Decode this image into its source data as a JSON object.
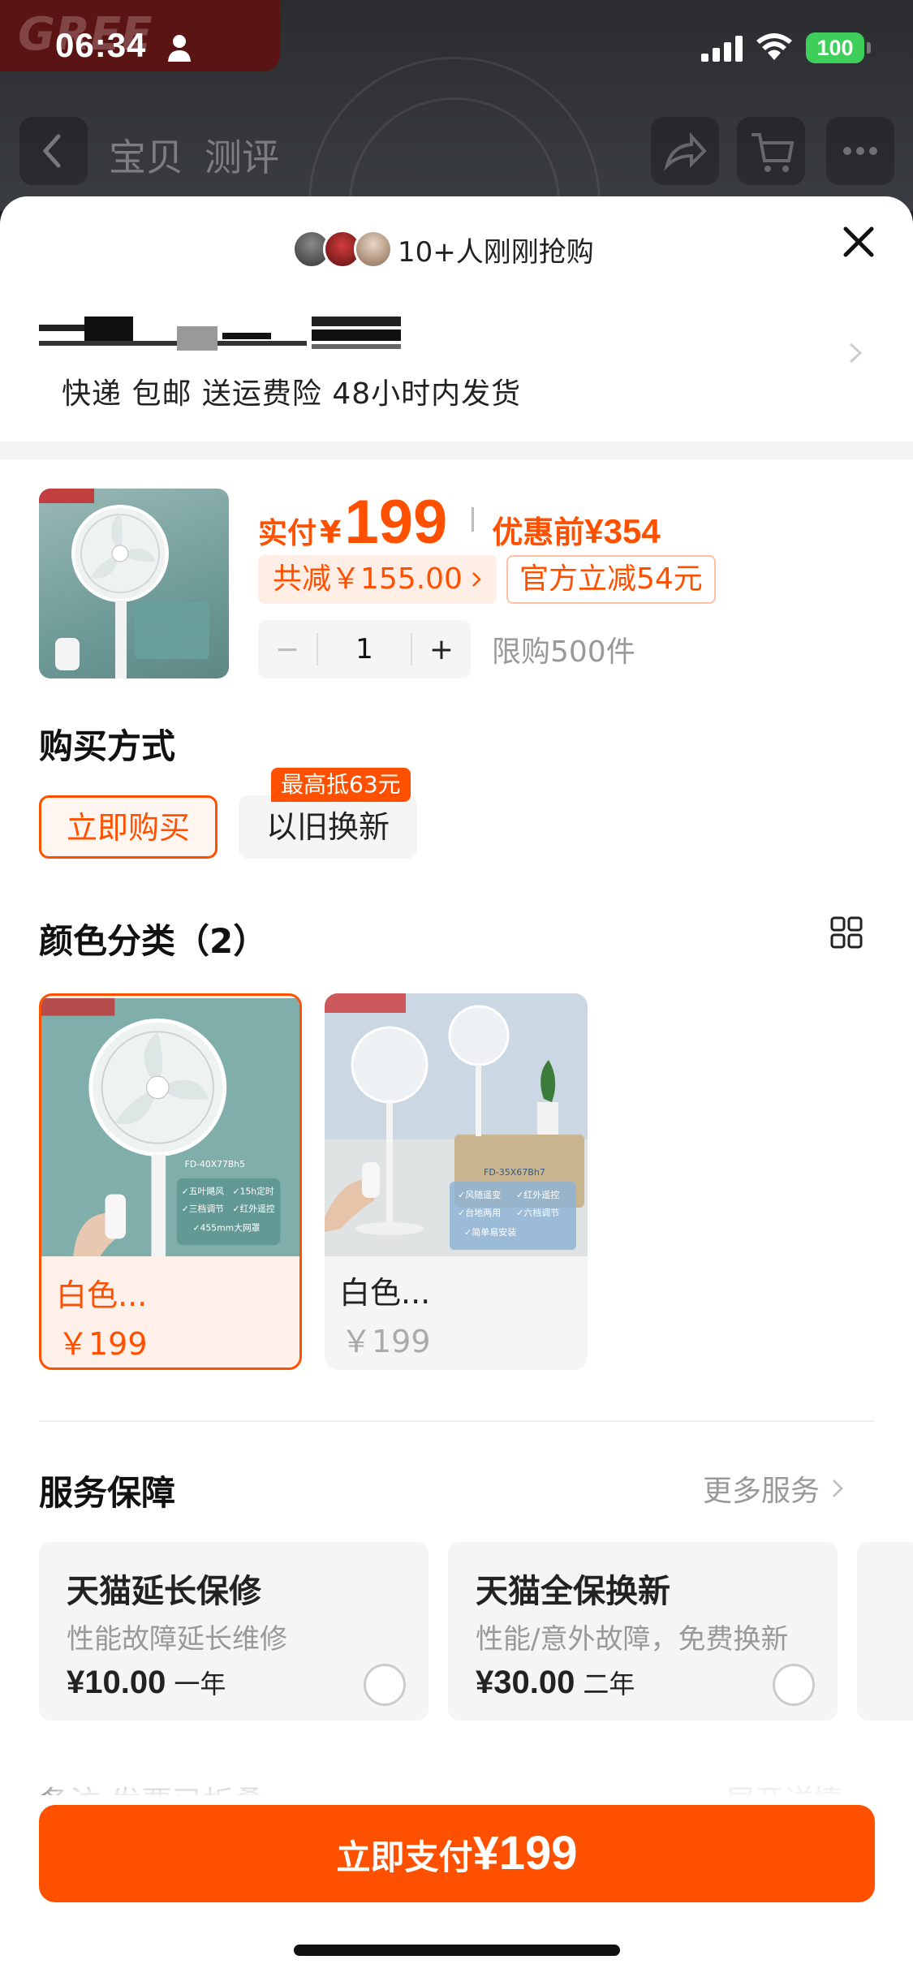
{
  "status_bar": {
    "time": "06:34",
    "battery": "100"
  },
  "background_page": {
    "tabs": [
      "宝贝",
      "测评"
    ]
  },
  "sheet": {
    "buyers_text": "10+人刚刚抢购",
    "shipping": "快递 包邮 送运费险 48小时内发货"
  },
  "product": {
    "pay_label": "实付",
    "yen": "¥",
    "pay_amount": "199",
    "orig_label": "优惠前",
    "orig_amount": "¥354",
    "discount_total": "共减￥155.00",
    "discount_official": "官方立减54元",
    "quantity": "1",
    "limit": "限购500件"
  },
  "purchase_method": {
    "title": "购买方式",
    "options": [
      "立即购买",
      "以旧换新"
    ],
    "selected": "立即购买",
    "trade_badge": "最高抵63元"
  },
  "colors": {
    "title": "颜色分类（2）",
    "variants": [
      {
        "name": "白色...",
        "price": "￥199"
      },
      {
        "name": "白色...",
        "price": "￥199"
      }
    ],
    "product_labels": {
      "v1_model": "FD-40X77Bh5",
      "v1_features": [
        "✓五叶飓风",
        "✓15h定时",
        "✓三档调节",
        "✓红外遥控",
        "✓455mm大网罩"
      ],
      "v2_model": "FD-35X67Bh7",
      "v2_features": [
        "✓风随遥变",
        "✓红外遥控",
        "✓台地两用",
        "✓六档调节",
        "✓简单易安装"
      ]
    }
  },
  "services": {
    "title": "服务保障",
    "more": "更多服务",
    "cards": [
      {
        "title": "天猫延长保修",
        "desc": "性能故障延长维修",
        "price": "¥10.00",
        "term": "一年"
      },
      {
        "title": "天猫全保换新",
        "desc": "性能/意外故障，免费换新",
        "price": "¥30.00",
        "term": "二年"
      }
    ]
  },
  "note": {
    "left": "备注 发票已折叠",
    "right": "展开详情"
  },
  "pay_button": {
    "label": "立即支付",
    "amount": "¥199"
  },
  "colors_palette": {
    "accent": "#ff5000",
    "accent_light": "#fff1ea",
    "battery": "#3ecf5a"
  }
}
